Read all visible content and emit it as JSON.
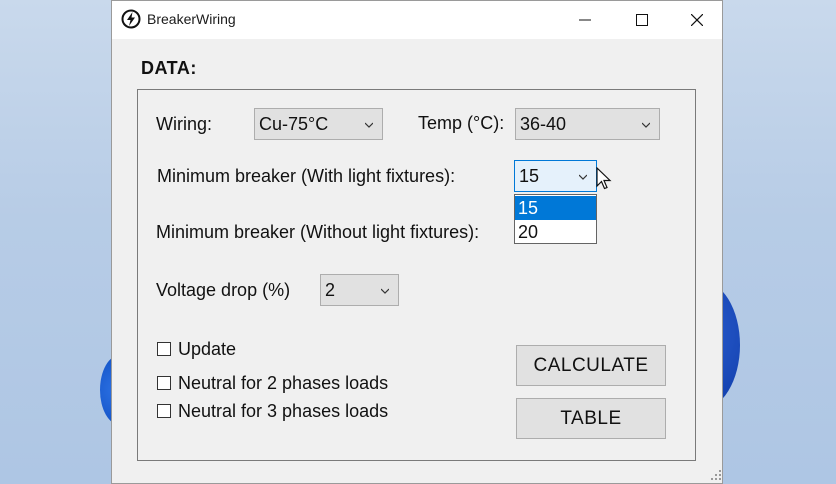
{
  "window": {
    "title": "BreakerWiring"
  },
  "section_title": "DATA:",
  "fields": {
    "wiring": {
      "label": "Wiring:",
      "value": "Cu-75°C"
    },
    "temp": {
      "label": "Temp (°C):",
      "value": "36-40"
    },
    "min_breaker_with": {
      "label": "Minimum breaker (With light fixtures):",
      "value": "15"
    },
    "min_breaker_without": {
      "label": "Minimum breaker (Without light fixtures):"
    },
    "voltage_drop": {
      "label": "Voltage drop (%)",
      "value": "2"
    }
  },
  "dropdown_options": [
    "15",
    "20"
  ],
  "checkboxes": {
    "update": "Update",
    "neutral2": "Neutral for 2 phases loads",
    "neutral3": "Neutral for 3 phases loads"
  },
  "buttons": {
    "calculate": "CALCULATE",
    "table": "TABLE"
  },
  "colors": {
    "selection": "#0078d7",
    "window_bg": "#f0f0f0"
  },
  "icons": [
    "app-lightning-icon",
    "minimize-icon",
    "maximize-icon",
    "close-icon",
    "chevron-down-icon",
    "mouse-cursor-icon",
    "resize-grip-icon"
  ]
}
